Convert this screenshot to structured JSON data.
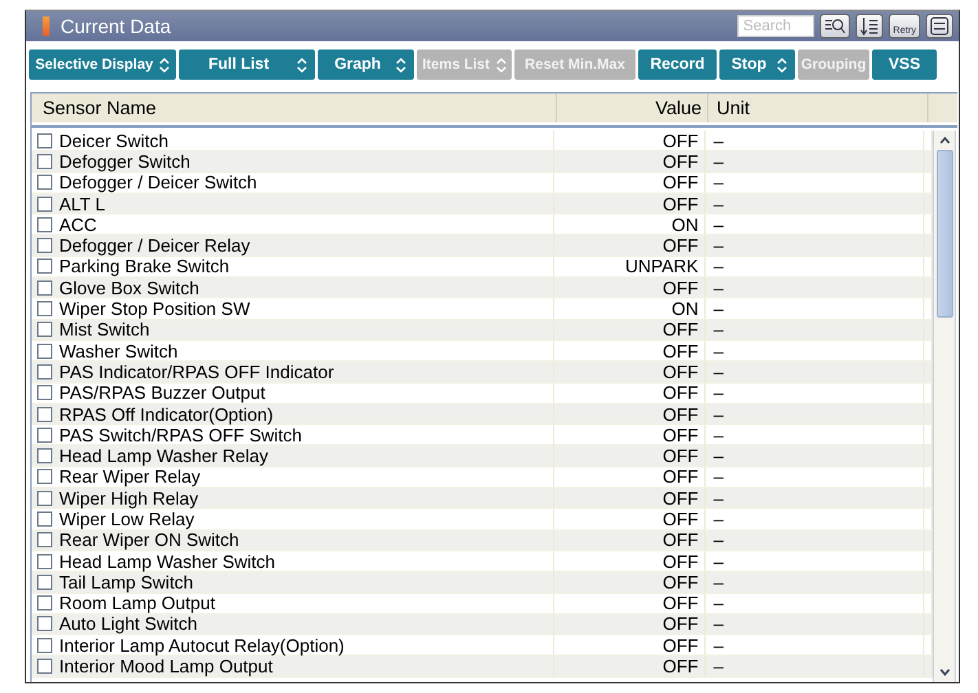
{
  "window": {
    "title": "Current Data"
  },
  "search": {
    "placeholder": "Search"
  },
  "retry_label": "Retry",
  "toolbar": [
    {
      "label": "Selective Display",
      "dropdown": true,
      "disabled": false
    },
    {
      "label": "Full List",
      "dropdown": true,
      "disabled": false
    },
    {
      "label": "Graph",
      "dropdown": true,
      "disabled": false
    },
    {
      "label": "Items List",
      "dropdown": true,
      "disabled": true
    },
    {
      "label": "Reset Min.Max",
      "dropdown": false,
      "disabled": true
    },
    {
      "label": "Record",
      "dropdown": false,
      "disabled": false
    },
    {
      "label": "Stop",
      "dropdown": true,
      "disabled": false
    },
    {
      "label": "Grouping",
      "dropdown": false,
      "disabled": true
    },
    {
      "label": "VSS",
      "dropdown": false,
      "disabled": false
    }
  ],
  "table": {
    "columns": [
      "Sensor Name",
      "Value",
      "Unit"
    ],
    "rows": [
      {
        "name": "Deicer Switch",
        "value": "OFF",
        "unit": "–",
        "checked": false
      },
      {
        "name": "Defogger Switch",
        "value": "OFF",
        "unit": "–",
        "checked": false
      },
      {
        "name": "Defogger / Deicer Switch",
        "value": "OFF",
        "unit": "–",
        "checked": false
      },
      {
        "name": "ALT L",
        "value": "OFF",
        "unit": "–",
        "checked": false
      },
      {
        "name": "ACC",
        "value": "ON",
        "unit": "–",
        "checked": false
      },
      {
        "name": "Defogger / Deicer Relay",
        "value": "OFF",
        "unit": "–",
        "checked": false
      },
      {
        "name": "Parking Brake Switch",
        "value": "UNPARK",
        "unit": "–",
        "checked": false
      },
      {
        "name": "Glove Box Switch",
        "value": "OFF",
        "unit": "–",
        "checked": false
      },
      {
        "name": "Wiper Stop Position SW",
        "value": "ON",
        "unit": "–",
        "checked": false
      },
      {
        "name": "Mist Switch",
        "value": "OFF",
        "unit": "–",
        "checked": false
      },
      {
        "name": "Washer Switch",
        "value": "OFF",
        "unit": "–",
        "checked": false
      },
      {
        "name": "PAS Indicator/RPAS OFF Indicator",
        "value": "OFF",
        "unit": "–",
        "checked": false
      },
      {
        "name": "PAS/RPAS Buzzer Output",
        "value": "OFF",
        "unit": "–",
        "checked": false
      },
      {
        "name": "RPAS Off Indicator(Option)",
        "value": "OFF",
        "unit": "–",
        "checked": false
      },
      {
        "name": "PAS Switch/RPAS OFF Switch",
        "value": "OFF",
        "unit": "–",
        "checked": false
      },
      {
        "name": "Head Lamp Washer Relay",
        "value": "OFF",
        "unit": "–",
        "checked": false
      },
      {
        "name": "Rear Wiper Relay",
        "value": "OFF",
        "unit": "–",
        "checked": false
      },
      {
        "name": "Wiper High Relay",
        "value": "OFF",
        "unit": "–",
        "checked": false
      },
      {
        "name": "Wiper Low Relay",
        "value": "OFF",
        "unit": "–",
        "checked": false
      },
      {
        "name": "Rear Wiper ON Switch",
        "value": "OFF",
        "unit": "–",
        "checked": false
      },
      {
        "name": "Head Lamp Washer Switch",
        "value": "OFF",
        "unit": "–",
        "checked": false
      },
      {
        "name": "Tail Lamp Switch",
        "value": "OFF",
        "unit": "–",
        "checked": false
      },
      {
        "name": "Room Lamp Output",
        "value": "OFF",
        "unit": "–",
        "checked": false
      },
      {
        "name": "Auto Light Switch",
        "value": "OFF",
        "unit": "–",
        "checked": false
      },
      {
        "name": "Interior Lamp Autocut Relay(Option)",
        "value": "OFF",
        "unit": "–",
        "checked": false
      },
      {
        "name": "Interior Mood Lamp Output",
        "value": "OFF",
        "unit": "–",
        "checked": false
      }
    ]
  }
}
